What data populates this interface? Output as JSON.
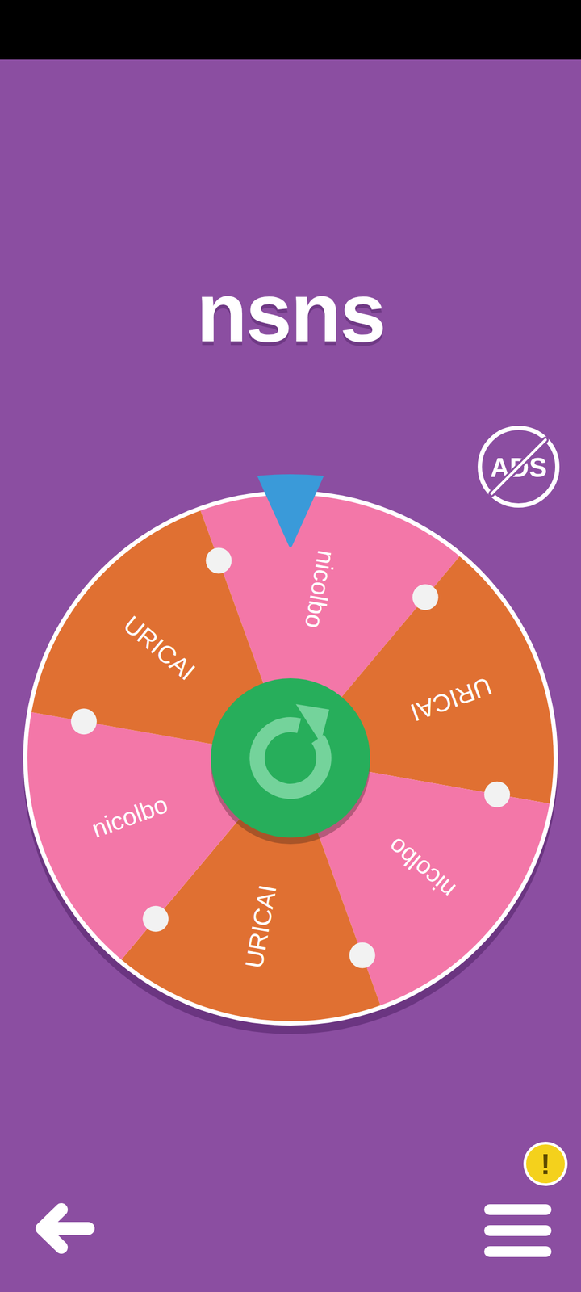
{
  "title": "nsns",
  "no_ads_button": {
    "label": "ADS"
  },
  "wheel": {
    "segments": [
      {
        "label": "nicolbo",
        "color": "#f377a8",
        "selected": true
      },
      {
        "label": "URICAI",
        "color": "#e07032",
        "selected": false
      },
      {
        "label": "nicolbo",
        "color": "#f377a8",
        "selected": false
      },
      {
        "label": "URICAI",
        "color": "#e07032",
        "selected": false
      },
      {
        "label": "nicolbo",
        "color": "#f377a8",
        "selected": false
      },
      {
        "label": "URICAI",
        "color": "#e07032",
        "selected": false
      }
    ]
  },
  "menu_badge": "!"
}
